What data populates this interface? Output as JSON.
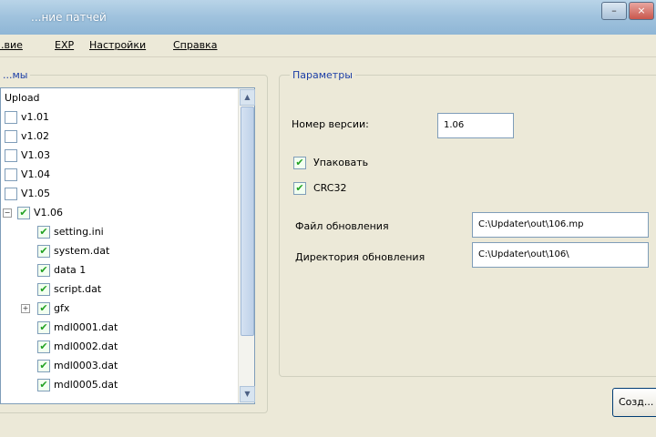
{
  "window": {
    "title": "...ние патчей",
    "min_label": "–",
    "close_label": "×"
  },
  "menu": [
    "...вие",
    "EXP",
    "Настройки",
    "Справка"
  ],
  "left_panel": {
    "legend": "...мы",
    "tree": [
      {
        "label": "Upload",
        "indent": 0,
        "checkbox": false,
        "checked": false,
        "expander": ""
      },
      {
        "label": "v1.01",
        "indent": 1,
        "checkbox": true,
        "checked": false,
        "expander": ""
      },
      {
        "label": "v1.02",
        "indent": 1,
        "checkbox": true,
        "checked": false,
        "expander": ""
      },
      {
        "label": "V1.03",
        "indent": 1,
        "checkbox": true,
        "checked": false,
        "expander": ""
      },
      {
        "label": "V1.04",
        "indent": 1,
        "checkbox": true,
        "checked": false,
        "expander": ""
      },
      {
        "label": "V1.05",
        "indent": 1,
        "checkbox": true,
        "checked": false,
        "expander": ""
      },
      {
        "label": "V1.06",
        "indent": 1,
        "checkbox": true,
        "checked": true,
        "expander": "−"
      },
      {
        "label": "setting.ini",
        "indent": 2,
        "checkbox": true,
        "checked": true,
        "expander": ""
      },
      {
        "label": "system.dat",
        "indent": 2,
        "checkbox": true,
        "checked": true,
        "expander": ""
      },
      {
        "label": "data 1",
        "indent": 2,
        "checkbox": true,
        "checked": true,
        "expander": ""
      },
      {
        "label": "script.dat",
        "indent": 2,
        "checkbox": true,
        "checked": true,
        "expander": ""
      },
      {
        "label": "gfx",
        "indent": 2,
        "checkbox": true,
        "checked": true,
        "expander": "+"
      },
      {
        "label": "mdl0001.dat",
        "indent": 2,
        "checkbox": true,
        "checked": true,
        "expander": ""
      },
      {
        "label": "mdl0002.dat",
        "indent": 2,
        "checkbox": true,
        "checked": true,
        "expander": ""
      },
      {
        "label": "mdl0003.dat",
        "indent": 2,
        "checkbox": true,
        "checked": true,
        "expander": ""
      },
      {
        "label": "mdl0005.dat",
        "indent": 2,
        "checkbox": true,
        "checked": true,
        "expander": ""
      }
    ]
  },
  "params": {
    "legend": "Параметры",
    "version_label": "Номер версии:",
    "version_value": "1.06",
    "pack_label": "Упаковать",
    "pack_checked": true,
    "crc_label": "CRC32",
    "crc_checked": true,
    "update_file_label": "Файл обновления",
    "update_file_value": "C:\\Updater\\out\\106.mp",
    "update_dir_label": "Директория обновления",
    "update_dir_value": "C:\\Updater\\out\\106\\"
  },
  "create_button": "Созд..."
}
